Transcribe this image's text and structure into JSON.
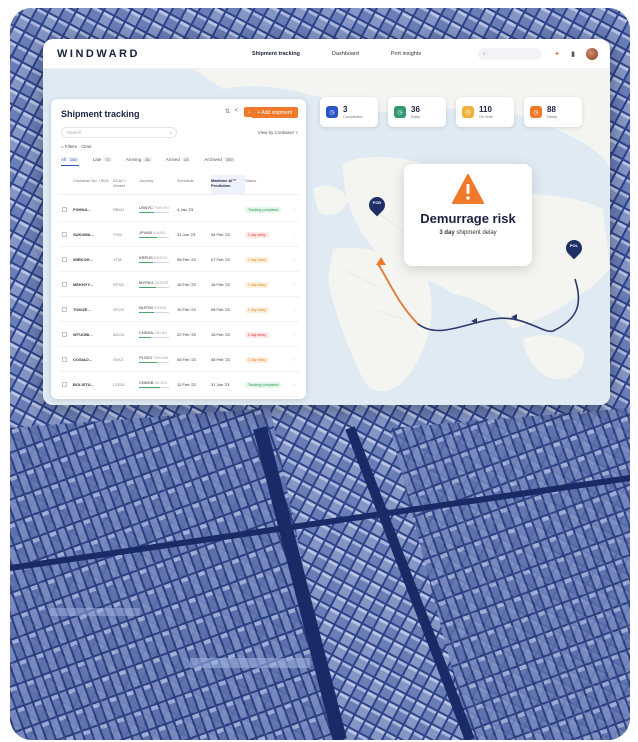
{
  "app": {
    "logo": "WINDWARD",
    "nav": [
      "Shipment tracking",
      "Dashboard",
      "Port insights"
    ],
    "search_placeholder": ""
  },
  "panel": {
    "title": "Shipment tracking",
    "add_button": "+ Add shipment",
    "search_placeholder": "Search",
    "view_by": "View by  Container ˅",
    "filters": "= Filters  ·  Clear",
    "tabs": [
      {
        "label": "All",
        "count": "160"
      },
      {
        "label": "Late",
        "count": "71"
      },
      {
        "label": "Arriving",
        "count": "26"
      },
      {
        "label": "Arrived",
        "count": "13"
      },
      {
        "label": "Archived",
        "count": "200"
      }
    ],
    "columns": [
      "Container No. / BOL",
      "SCAC / Vessel",
      "Journey",
      "Schedule",
      "Maritime AI™ Prediction",
      "Status"
    ],
    "rows": [
      {
        "id": "FGHNA...",
        "sub": "",
        "scac": "SEKU",
        "from": "USNYC",
        "to": "TWKHH",
        "sched": "4 Jan '23",
        "pred": "",
        "status": "Tracking completed",
        "kind": "green",
        "progress": 0.5
      },
      {
        "id": "SUKUMA...",
        "sub": "",
        "scac": "YYM",
        "from": "JPUKB",
        "to": "AUMEL",
        "sched": "31 Jan '23",
        "pred": "04 Feb '23",
        "status": "1 day delay",
        "kind": "red",
        "progress": 0.6
      },
      {
        "id": "WIEKOH...",
        "sub": "",
        "scac": "YTM",
        "from": "KRPUS",
        "to": "BRSSZ",
        "sched": "06 Feb '23",
        "pred": "07 Feb '23",
        "status": "1 day delay",
        "kind": "orange",
        "progress": 0.45
      },
      {
        "id": "MEKHYY...",
        "sub": "",
        "scac": "STSD",
        "from": "MYPKG",
        "to": "ZADUR",
        "sched": "16 Feb '23",
        "pred": "18 Feb '23",
        "status": "1 day delay",
        "kind": "orange",
        "progress": 0.55
      },
      {
        "id": "TOKIZE...",
        "sub": "",
        "scac": "STCG",
        "from": "NLRTM",
        "to": "INNSA",
        "sched": "10 Feb '23",
        "pred": "08 Feb '23",
        "status": "1 day delay",
        "kind": "orange",
        "progress": 0.5
      },
      {
        "id": "WTUOBI...",
        "sub": "",
        "scac": "ACCU",
        "from": "CNSHA",
        "to": "USLAX",
        "sched": "22 Feb '23",
        "pred": "18 Feb '23",
        "status": "2 day delay",
        "kind": "red",
        "progress": 0.4
      },
      {
        "id": "COSIAO...",
        "sub": "",
        "scac": "OOCI",
        "from": "PLGDY",
        "to": "DEHAM",
        "sched": "05 Feb '23",
        "pred": "08 Feb '23",
        "status": "1 day delay",
        "kind": "orange",
        "progress": 0.6
      },
      {
        "id": "BOLISTU...",
        "sub": "",
        "scac": "COSU",
        "from": "CNNGB",
        "to": "AEJEA",
        "sched": "12 Feb '23",
        "pred": "31 Jan '23",
        "status": "Tracking completed",
        "kind": "green",
        "progress": 0.7
      }
    ]
  },
  "stats": [
    {
      "num": "3",
      "label": "Completed",
      "color": "#2a55c9",
      "icon": "clock-icon"
    },
    {
      "num": "36",
      "label": "Early",
      "color": "#2e9a6e",
      "icon": "clock-icon"
    },
    {
      "num": "110",
      "label": "On time",
      "color": "#f1b23a",
      "icon": "clock-icon"
    },
    {
      "num": "88",
      "label": "Delay",
      "color": "#f07a2a",
      "icon": "clock-icon"
    }
  ],
  "risk": {
    "title": "Demurrage risk",
    "days": "3 day",
    "subtitle": "shipment delay"
  },
  "pins": {
    "pod": "POD",
    "pol": "POL"
  }
}
